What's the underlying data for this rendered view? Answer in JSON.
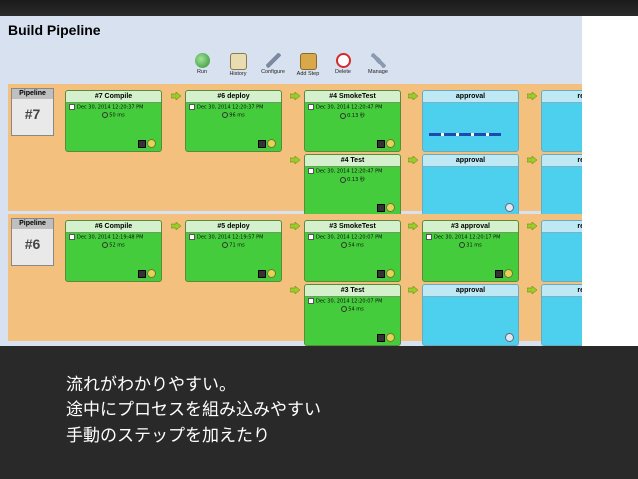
{
  "page_title": "Build Pipeline",
  "toolbar": {
    "run": "Run",
    "history": "History",
    "configure": "Configure",
    "add_step": "Add Step",
    "delete": "Delete",
    "manage": "Manage"
  },
  "pipelines": [
    {
      "label": "Pipeline",
      "number": "#7",
      "stages": [
        {
          "title": "#7 Compile",
          "timestamp": "Dec 30, 2014 12:20:37 PM",
          "duration": "50 ms"
        },
        {
          "title": "#6 deploy",
          "timestamp": "Dec 30, 2014 12:20:37 PM",
          "duration": "96 ms"
        },
        {
          "title": "#4 SmokeTest",
          "timestamp": "Dec 30, 2014 12:20:47 PM",
          "duration": "0.13 秒"
        },
        {
          "title": "approval",
          "timestamp": "",
          "duration": ""
        },
        {
          "title": "release",
          "timestamp": "",
          "duration": ""
        },
        {
          "title": "#4 Test",
          "timestamp": "Dec 30, 2014 12:20:47 PM",
          "duration": "0.13 秒"
        },
        {
          "title": "approval",
          "timestamp": "",
          "duration": ""
        },
        {
          "title": "release",
          "timestamp": "",
          "duration": ""
        }
      ]
    },
    {
      "label": "Pipeline",
      "number": "#6",
      "stages": [
        {
          "title": "#6 Compile",
          "timestamp": "Dec 30, 2014 12:19:48 PM",
          "duration": "52 ms"
        },
        {
          "title": "#5 deploy",
          "timestamp": "Dec 30, 2014 12:19:57 PM",
          "duration": "71 ms"
        },
        {
          "title": "#3 SmokeTest",
          "timestamp": "Dec 30, 2014 12:20:07 PM",
          "duration": "54 ms"
        },
        {
          "title": "#3 approval",
          "timestamp": "Dec 30, 2014 12:20:17 PM",
          "duration": "31 ms"
        },
        {
          "title": "release",
          "timestamp": "",
          "duration": ""
        },
        {
          "title": "#3 Test",
          "timestamp": "Dec 30, 2014 12:20:07 PM",
          "duration": "54 ms"
        },
        {
          "title": "approval",
          "timestamp": "",
          "duration": ""
        },
        {
          "title": "release",
          "timestamp": "",
          "duration": ""
        }
      ]
    }
  ],
  "caption": {
    "line1": "流れがわかりやすい。",
    "line2": "途中にプロセスを組み込みやすい",
    "line3": "手動のステップを加えたり"
  },
  "colors": {
    "success": "#44cc3c",
    "pending": "#4dcfee",
    "row_background": "#f3c07d",
    "arrow": "#9ccc2a"
  }
}
